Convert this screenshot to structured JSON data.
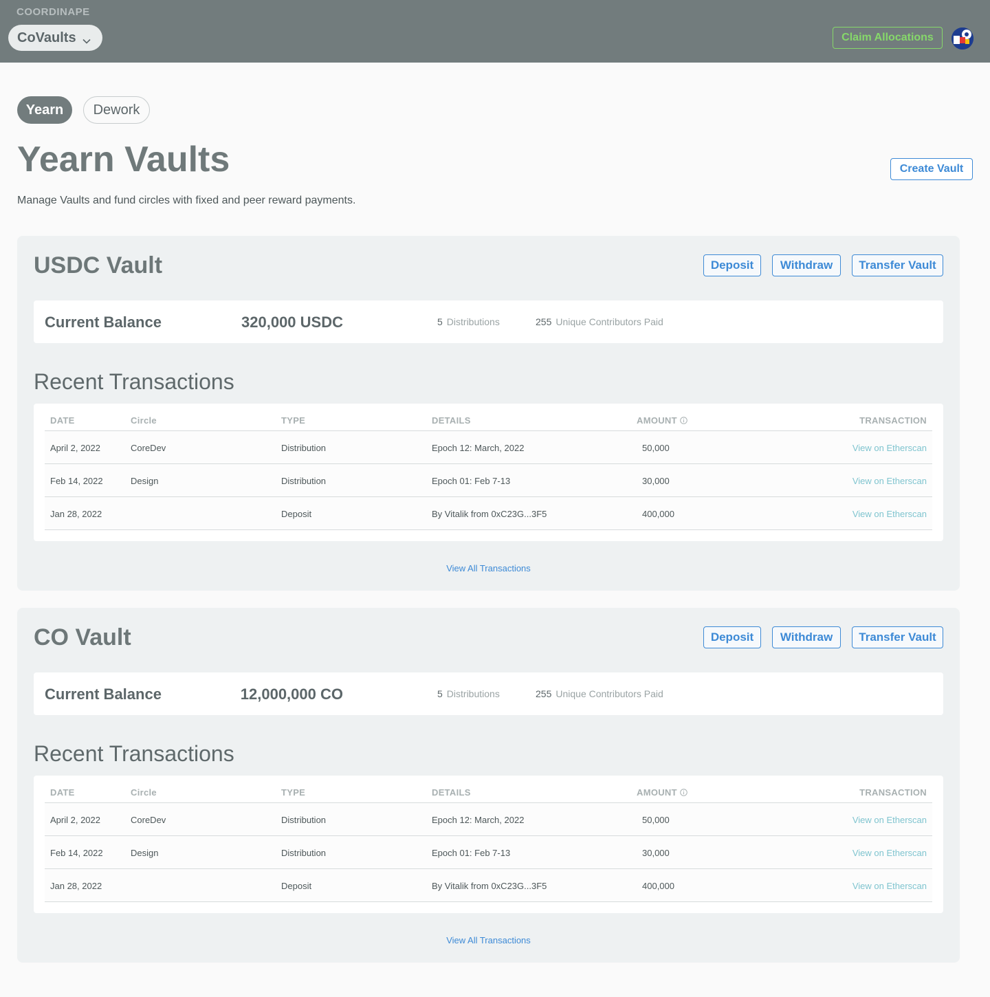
{
  "header": {
    "brand": "COORDINAPE",
    "circle_select": "CoVaults",
    "claim_label": "Claim Allocations"
  },
  "tabs": [
    {
      "label": "Yearn",
      "active": true
    },
    {
      "label": "Dework",
      "active": false
    }
  ],
  "page": {
    "title": "Yearn Vaults",
    "subtitle": "Manage Vaults and fund circles with fixed and peer reward payments.",
    "create_label": "Create Vault"
  },
  "vault_actions": {
    "deposit": "Deposit",
    "withdraw": "Withdraw",
    "transfer": "Transfer Vault"
  },
  "table_headers": {
    "date": "DATE",
    "circle": "Circle",
    "type": "TYPE",
    "details": "DETAILS",
    "amount": "AMOUNT",
    "transaction": "TRANSACTION"
  },
  "vaults": [
    {
      "title": "USDC Vault",
      "balance_label": "Current Balance",
      "balance_amount": "320,000  USDC",
      "distributions_count": "5",
      "distributions_label": "Distributions",
      "contributors_count": "255",
      "contributors_label": "Unique Contributors Paid",
      "recent_title": "Recent Transactions",
      "view_all": "View All Transactions",
      "rows": [
        {
          "date": "April 2, 2022",
          "circle": "CoreDev",
          "type": "Distribution",
          "details": "Epoch 12: March, 2022",
          "amount": "50,000",
          "link": "View on Etherscan"
        },
        {
          "date": "Feb 14, 2022",
          "circle": "Design",
          "type": "Distribution",
          "details": "Epoch 01: Feb 7-13",
          "amount": "30,000",
          "link": "View on Etherscan"
        },
        {
          "date": "Jan 28, 2022",
          "circle": "",
          "type": "Deposit",
          "details": "By Vitalik from 0xC23G...3F5",
          "amount": "400,000",
          "link": "View on Etherscan"
        }
      ]
    },
    {
      "title": "CO Vault",
      "balance_label": "Current Balance",
      "balance_amount": "12,000,000  CO",
      "distributions_count": "5",
      "distributions_label": "Distributions",
      "contributors_count": "255",
      "contributors_label": "Unique Contributors Paid",
      "recent_title": "Recent Transactions",
      "view_all": "View All Transactions",
      "rows": [
        {
          "date": "April 2, 2022",
          "circle": "CoreDev",
          "type": "Distribution",
          "details": "Epoch 12: March, 2022",
          "amount": "50,000",
          "link": "View on Etherscan"
        },
        {
          "date": "Feb 14, 2022",
          "circle": "Design",
          "type": "Distribution",
          "details": "Epoch 01: Feb 7-13",
          "amount": "30,000",
          "link": "View on Etherscan"
        },
        {
          "date": "Jan 28, 2022",
          "circle": "",
          "type": "Deposit",
          "details": "By Vitalik from 0xC23G...3F5",
          "amount": "400,000",
          "link": "View on Etherscan"
        }
      ]
    }
  ]
}
